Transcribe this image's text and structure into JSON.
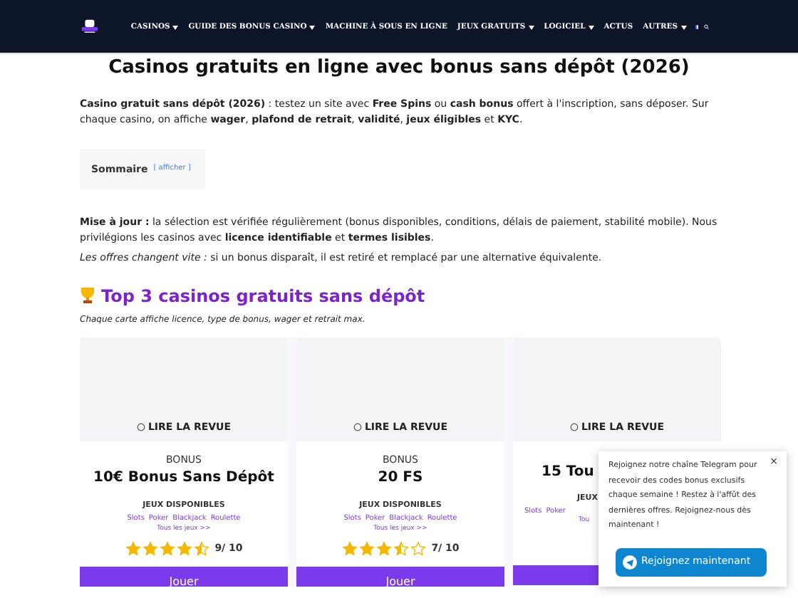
{
  "nav": {
    "items": [
      {
        "label": "CASINOS",
        "dropdown": true
      },
      {
        "label": "GUIDE DES BONUS CASINO",
        "dropdown": true
      },
      {
        "label": "MACHINE À SOUS EN LIGNE",
        "dropdown": false
      },
      {
        "label": "JEUX GRATUITS",
        "dropdown": true
      },
      {
        "label": "LOGICIEL",
        "dropdown": true
      },
      {
        "label": "ACTUS",
        "dropdown": false
      },
      {
        "label": "AUTRES",
        "dropdown": true
      }
    ]
  },
  "title": "Casinos gratuits en ligne avec bonus sans dépôt (2026)",
  "intro": "**Casino gratuit sans dépôt (2026)** : testez un site avec **Free Spins** ou **cash bonus** offert à l'inscription, sans déposer. Sur chaque casino, on affiche **wager**, **plafond de retrait**, **validité**, **jeux éligibles** et **KYC**.",
  "toc": {
    "label": "Sommaire",
    "link": "[ afficher ]"
  },
  "update": "**Mise à jour :** la sélection est vérifiée régulièrement (bonus disponibles, conditions, délais de paiement, stabilité mobile). Nous privilégions les casinos avec **licence identifiable** et **termes lisibles**.",
  "note": "*Les offres changent vite :* si un bonus disparaît, il est retiré et remplacé par une alternative équivalente.",
  "section": {
    "title": "Top 3 casinos gratuits sans dépôt",
    "subtitle": "Chaque carte affiche licence, type de bonus, wager et retrait max."
  },
  "cards": [
    {
      "review": "LIRE LA REVUE",
      "bonus_label": "BONUS",
      "bonus": "10€ Bonus Sans Dépôt",
      "games_label": "JEUX DISPONIBLES",
      "games": [
        "Slots",
        "Poker",
        "Blackjack",
        "Roulette"
      ],
      "all_games": "Tous les jeux >>",
      "stars": 4.5,
      "score": "9/ 10",
      "button": "Jouer"
    },
    {
      "review": "LIRE LA REVUE",
      "bonus_label": "BONUS",
      "bonus": "20 FS",
      "games_label": "JEUX DISPONIBLES",
      "games": [
        "Slots",
        "Poker",
        "Blackjack",
        "Roulette"
      ],
      "all_games": "Tous les jeux >>",
      "stars": 3.5,
      "score": "7/ 10",
      "button": "Jouer"
    },
    {
      "review": "LIRE LA REVUE",
      "bonus": "15 Tou",
      "games_label": "JEUX",
      "games": [
        "Slots",
        "Poker"
      ],
      "all_games": "Tou"
    }
  ],
  "popup": {
    "text": "Rejoignez notre chaîne Telegram pour recevoir des codes bonus exclusifs chaque semaine ! Restez à l'affût des dernières offres. Rejoignez-nous dès maintenant !",
    "close": "×",
    "button": "Rejoignez maintenant"
  }
}
